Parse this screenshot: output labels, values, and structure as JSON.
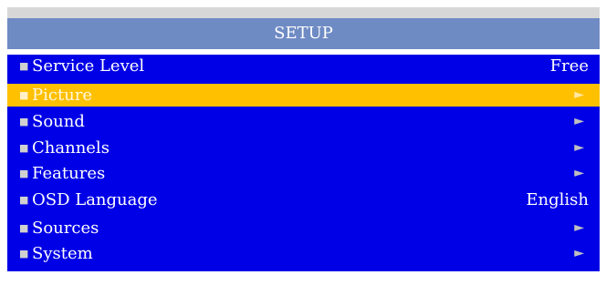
{
  "header": {
    "title": "SETUP"
  },
  "menu": {
    "items": [
      {
        "label": "Service Level",
        "value": "Free",
        "arrow": "",
        "selected": false
      },
      {
        "label": "Picture",
        "value": "",
        "arrow": "►",
        "selected": true
      },
      {
        "label": "Sound",
        "value": "",
        "arrow": "►",
        "selected": false
      },
      {
        "label": "Channels",
        "value": "",
        "arrow": "►",
        "selected": false
      },
      {
        "label": "Features",
        "value": "",
        "arrow": "►",
        "selected": false
      },
      {
        "label": "OSD Language",
        "value": "English",
        "arrow": "",
        "selected": false
      },
      {
        "label": "Sources",
        "value": "",
        "arrow": "►",
        "selected": false
      },
      {
        "label": "System",
        "value": "",
        "arrow": "►",
        "selected": false
      }
    ],
    "bullet_char": "■"
  },
  "colors": {
    "background": "#0000e6",
    "title_bar": "#6f8bc4",
    "selected_row": "#ffc000",
    "text": "#ffffff"
  }
}
